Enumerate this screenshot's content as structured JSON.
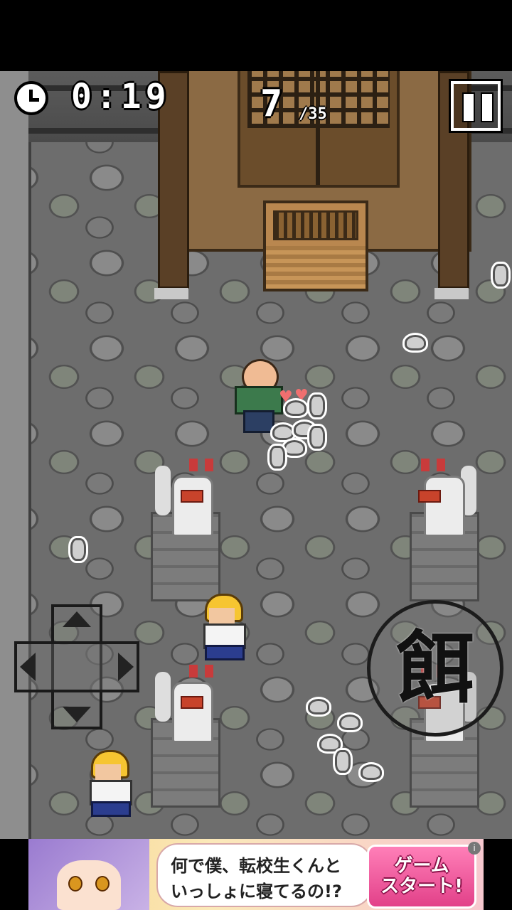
{
  "hud": {
    "clock_icon": "clock-icon",
    "timer": "0:19",
    "count": "7",
    "total": "/35",
    "pause_icon": "pause-icon"
  },
  "controls": {
    "dpad_icons": [
      "dpad-up-icon",
      "dpad-down-icon",
      "dpad-left-icon",
      "dpad-right-icon"
    ],
    "feed_button_label": "餌"
  },
  "ad": {
    "line1": "何で僕、転校生くんと",
    "line2": "いっしょに寝てるの!?",
    "cta_line1": "ゲーム",
    "cta_line2": "スタート!",
    "info_icon": "i"
  },
  "colors": {
    "ground": "#6d6d6d",
    "shrine_wood": "#8b6a44",
    "hud_text": "#ffffff",
    "ad_cta": "#e24189"
  }
}
